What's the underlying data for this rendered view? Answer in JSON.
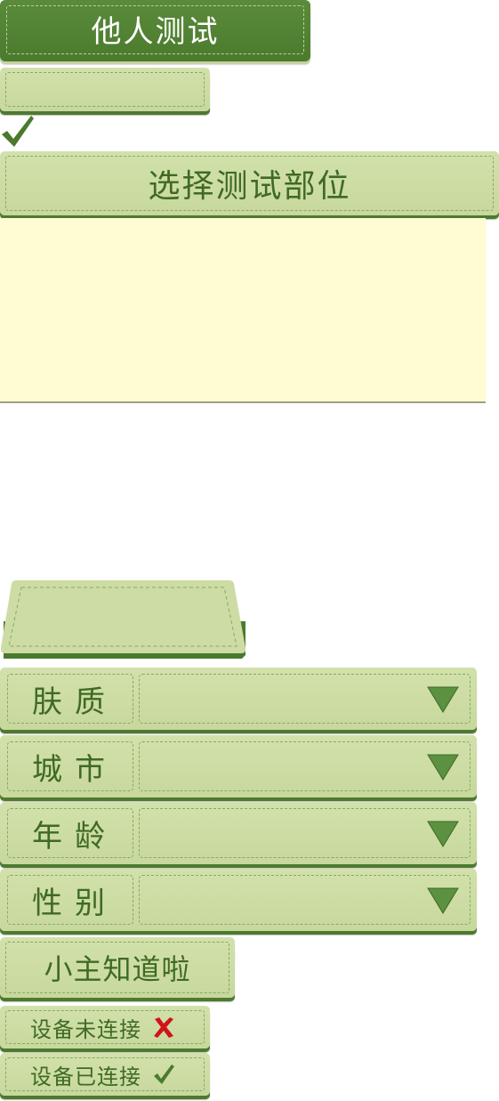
{
  "header": {
    "tab_label": "他人测试"
  },
  "select_part": {
    "label": "选择测试部位"
  },
  "fields": [
    {
      "label": "肤质",
      "value": ""
    },
    {
      "label": "城市",
      "value": ""
    },
    {
      "label": "年龄",
      "value": ""
    },
    {
      "label": "性别",
      "value": ""
    }
  ],
  "know_button": {
    "label": "小主知道啦"
  },
  "device_status": {
    "disconnected": "设备未连接",
    "connected": "设备已连接"
  },
  "colors": {
    "dark_green": "#4b7a2d",
    "panel_green": "#cddcA4",
    "text_green": "#3f6a24",
    "cream": "#fffbd2",
    "error_red": "#d0141a"
  },
  "icons": {
    "check": "check-icon",
    "cross": "cross-icon",
    "dropdown": "triangle-down-icon"
  }
}
